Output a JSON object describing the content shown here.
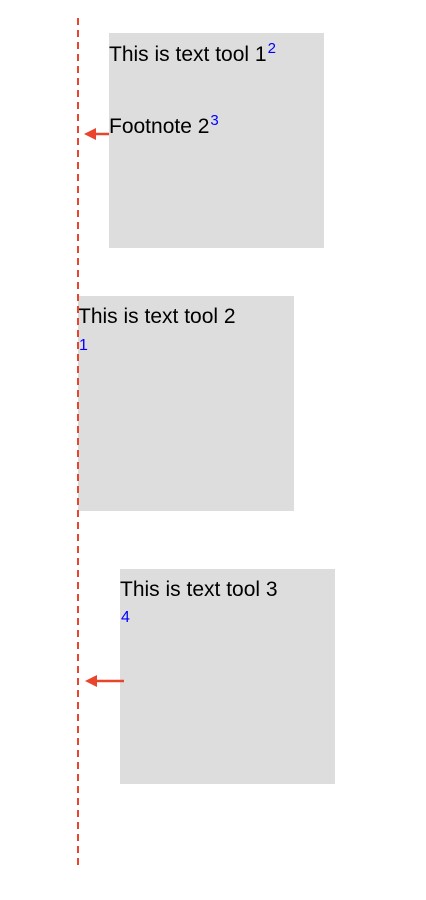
{
  "colors": {
    "guide": "#e8452c",
    "box_fill": "#dddddd",
    "text": "#000000",
    "marker": "#0000ff"
  },
  "boxes": [
    {
      "text": "This is text tool 1",
      "superscript": "2",
      "footnote": "Footnote 2",
      "footnote_superscript": "3"
    },
    {
      "text": "This is text tool 2",
      "reference": "1"
    },
    {
      "text": "This is text tool 3",
      "reference": "4"
    }
  ],
  "arrows": [
    {
      "direction": "left"
    },
    {
      "direction": "left"
    }
  ]
}
